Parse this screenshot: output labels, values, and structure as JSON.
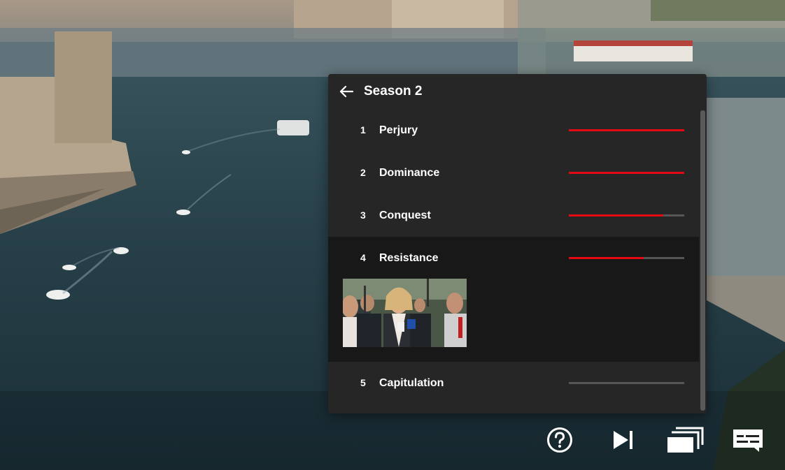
{
  "panel": {
    "back_icon": "arrow-left-icon",
    "season_title": "Season 2",
    "episodes": [
      {
        "number": "1",
        "title": "Perjury",
        "progress": 1.0
      },
      {
        "number": "2",
        "title": "Dominance",
        "progress": 1.0
      },
      {
        "number": "3",
        "title": "Conquest",
        "progress": 0.82
      },
      {
        "number": "4",
        "title": "Resistance",
        "progress": 0.65,
        "expanded": true
      },
      {
        "number": "5",
        "title": "Capitulation",
        "progress": 0.0
      }
    ]
  },
  "controls": [
    {
      "icon": "help-icon"
    },
    {
      "icon": "next-episode-icon"
    },
    {
      "icon": "episodes-icon"
    },
    {
      "icon": "subtitles-icon"
    }
  ],
  "colors": {
    "accent": "#e50914",
    "panel_bg": "#262626",
    "active_row_bg": "#181818"
  }
}
